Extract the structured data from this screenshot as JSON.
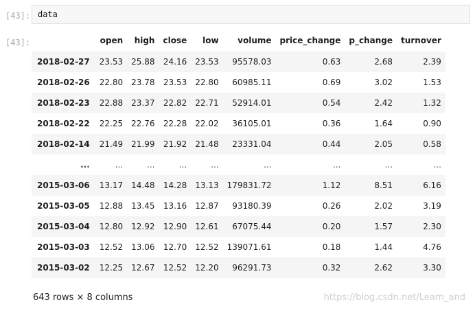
{
  "notebook": {
    "input_prompt": "[43]:",
    "output_prompt": "[43]:",
    "code": "data"
  },
  "table": {
    "columns": [
      "open",
      "high",
      "close",
      "low",
      "volume",
      "price_change",
      "p_change",
      "turnover"
    ],
    "rows": [
      {
        "index": "2018-02-27",
        "values": [
          "23.53",
          "25.88",
          "24.16",
          "23.53",
          "95578.03",
          "0.63",
          "2.68",
          "2.39"
        ]
      },
      {
        "index": "2018-02-26",
        "values": [
          "22.80",
          "23.78",
          "23.53",
          "22.80",
          "60985.11",
          "0.69",
          "3.02",
          "1.53"
        ]
      },
      {
        "index": "2018-02-23",
        "values": [
          "22.88",
          "23.37",
          "22.82",
          "22.71",
          "52914.01",
          "0.54",
          "2.42",
          "1.32"
        ]
      },
      {
        "index": "2018-02-22",
        "values": [
          "22.25",
          "22.76",
          "22.28",
          "22.02",
          "36105.01",
          "0.36",
          "1.64",
          "0.90"
        ]
      },
      {
        "index": "2018-02-14",
        "values": [
          "21.49",
          "21.99",
          "21.92",
          "21.48",
          "23331.04",
          "0.44",
          "2.05",
          "0.58"
        ]
      },
      {
        "index": "...",
        "values": [
          "...",
          "...",
          "...",
          "...",
          "...",
          "...",
          "...",
          "..."
        ]
      },
      {
        "index": "2015-03-06",
        "values": [
          "13.17",
          "14.48",
          "14.28",
          "13.13",
          "179831.72",
          "1.12",
          "8.51",
          "6.16"
        ]
      },
      {
        "index": "2015-03-05",
        "values": [
          "12.88",
          "13.45",
          "13.16",
          "12.87",
          "93180.39",
          "0.26",
          "2.02",
          "3.19"
        ]
      },
      {
        "index": "2015-03-04",
        "values": [
          "12.80",
          "12.92",
          "12.90",
          "12.61",
          "67075.44",
          "0.20",
          "1.57",
          "2.30"
        ]
      },
      {
        "index": "2015-03-03",
        "values": [
          "12.52",
          "13.06",
          "12.70",
          "12.52",
          "139071.61",
          "0.18",
          "1.44",
          "4.76"
        ]
      },
      {
        "index": "2015-03-02",
        "values": [
          "12.25",
          "12.67",
          "12.52",
          "12.20",
          "96291.73",
          "0.32",
          "2.62",
          "3.30"
        ]
      }
    ],
    "footer": "643 rows × 8 columns"
  },
  "watermark": "https://blog.csdn.net/Learn_and"
}
